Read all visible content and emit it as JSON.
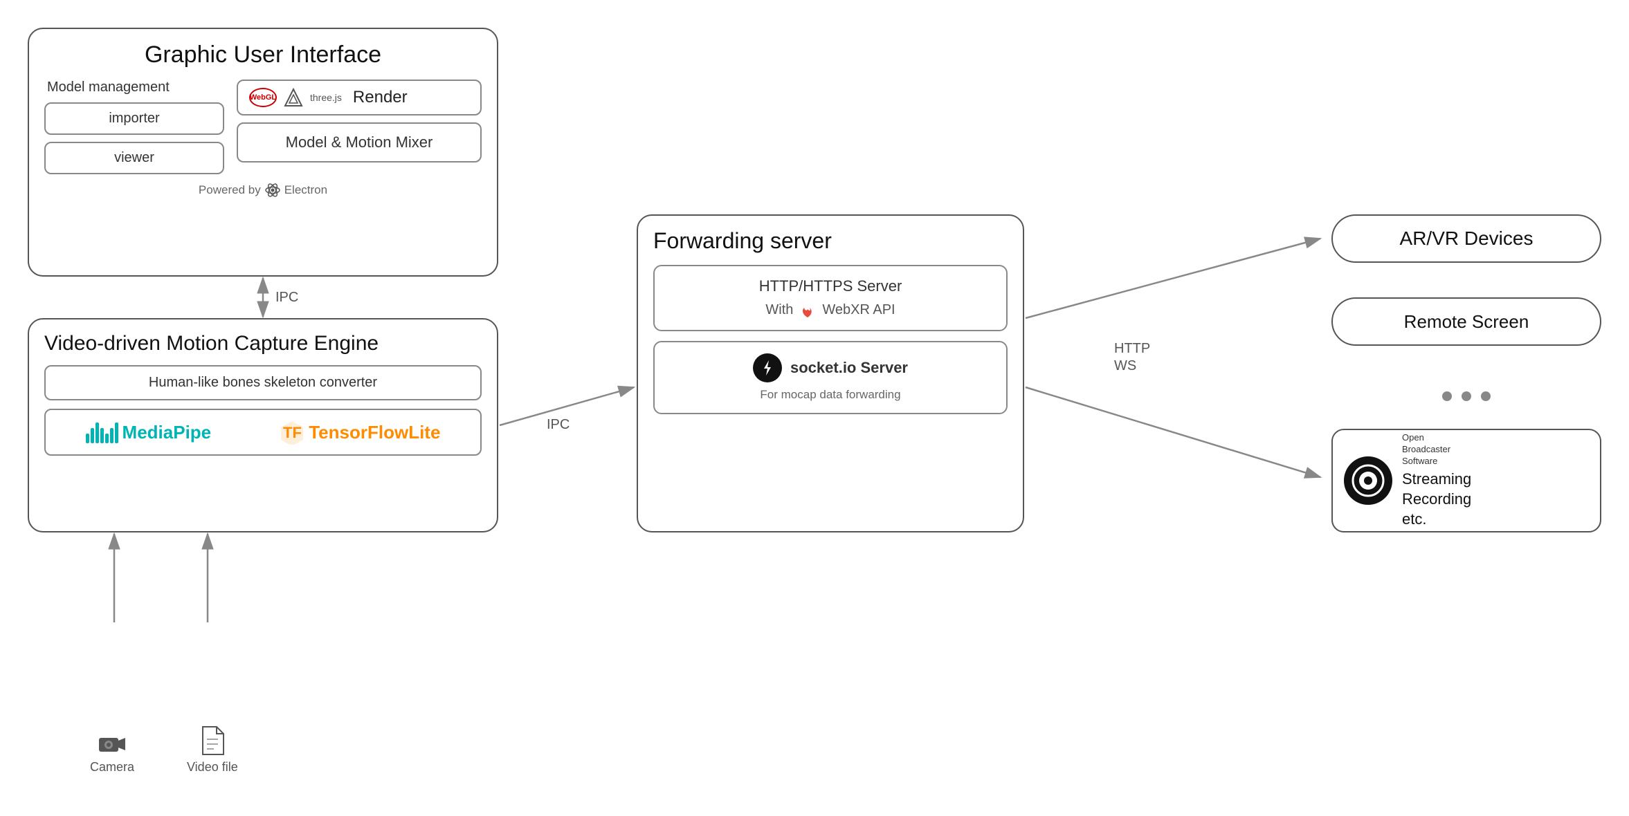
{
  "gui": {
    "title": "Graphic User Interface",
    "model_management_label": "Model management",
    "importer_label": "importer",
    "viewer_label": "viewer",
    "render_label": "Render",
    "threejs_label": "three.js",
    "model_motion_mixer_label": "Model & Motion Mixer",
    "powered_by_label": "Powered by",
    "electron_label": "Electron"
  },
  "mocap": {
    "title": "Video-driven Motion Capture Engine",
    "skeleton_label": "Human-like bones skeleton converter",
    "mediapipe_label": "MediaPipe",
    "tflite_label": "TensorFlowLite"
  },
  "forwarding": {
    "title": "Forwarding server",
    "http_title": "HTTP/HTTPS Server",
    "webxr_label": "With",
    "webxr_api_label": "WebXR API",
    "socketio_label": "socket.io Server",
    "socketio_desc": "For mocap data forwarding"
  },
  "right": {
    "arvr_label": "AR/VR Devices",
    "remote_screen_label": "Remote Screen",
    "obs_brand_line1": "Open",
    "obs_brand_line2": "Broadcaster",
    "obs_brand_line3": "Software",
    "obs_streaming": "Streaming\nRecording\netc."
  },
  "arrows": {
    "ipc_top_label": "IPC",
    "ipc_bottom_label": "IPC",
    "http_ws_label": "HTTP\nWS"
  },
  "camera": {
    "camera_label": "Camera",
    "video_label": "Video file"
  }
}
